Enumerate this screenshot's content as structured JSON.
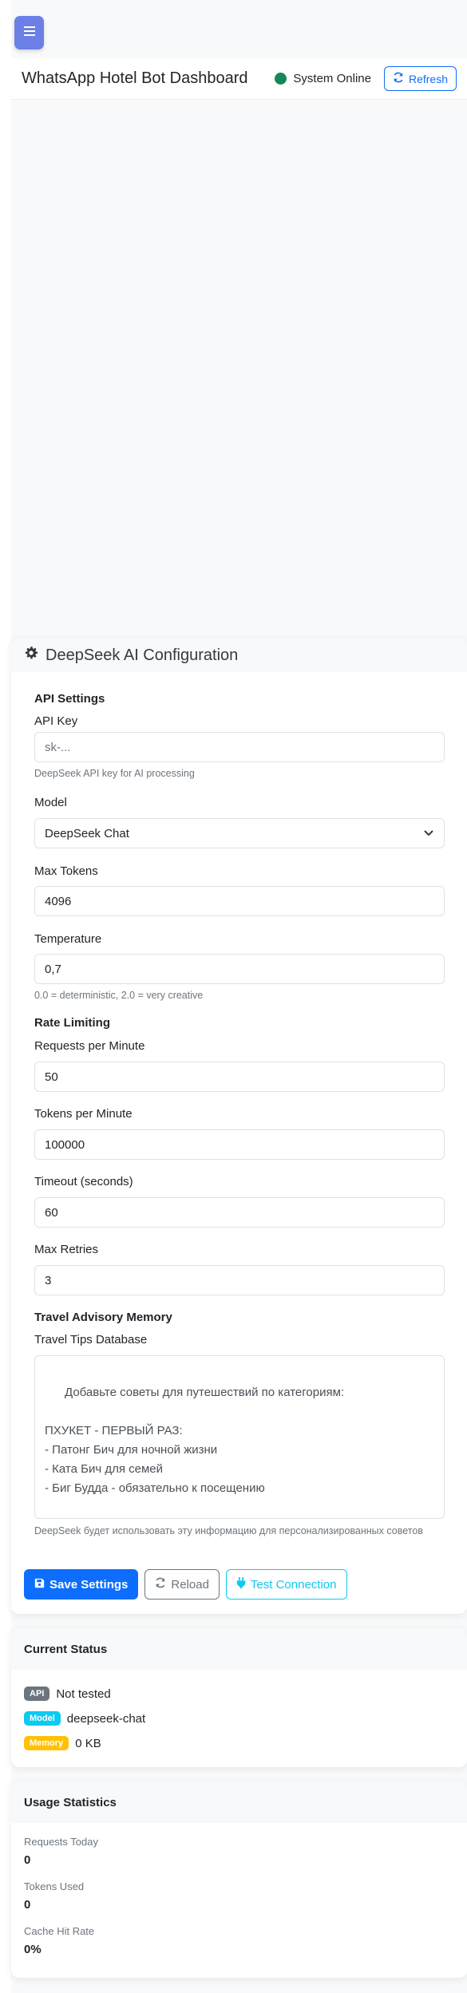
{
  "header": {
    "title": "WhatsApp Hotel Bot Dashboard",
    "status_text": "System Online",
    "refresh_label": "Refresh"
  },
  "config": {
    "title": "DeepSeek AI Configuration",
    "api_section": "API Settings",
    "api_key_label": "API Key",
    "api_key_placeholder": "sk-...",
    "api_key_help": "DeepSeek API key for AI processing",
    "model_label": "Model",
    "model_value": "DeepSeek Chat",
    "max_tokens_label": "Max Tokens",
    "max_tokens_value": "4096",
    "temperature_label": "Temperature",
    "temperature_value": "0,7",
    "temperature_help": "0.0 = deterministic, 2.0 = very creative",
    "rate_section": "Rate Limiting",
    "rpm_label": "Requests per Minute",
    "rpm_value": "50",
    "tpm_label": "Tokens per Minute",
    "tpm_value": "100000",
    "timeout_label": "Timeout (seconds)",
    "timeout_value": "60",
    "retries_label": "Max Retries",
    "retries_value": "3",
    "memory_section": "Travel Advisory Memory",
    "tips_label": "Travel Tips Database",
    "tips_value": "Добавьте советы для путешествий по категориям:\n\nПХУКЕТ - ПЕРВЫЙ РАЗ:\n- Патонг Бич для ночной жизни\n- Ката Бич для семей\n- Биг Будда - обязательно к посещению\n\nПХУКЕТ - С ДЕТЬМИ:",
    "tips_help": "DeepSeek будет использовать эту информацию для персонализированных советов",
    "save_label": "Save Settings",
    "reload_label": "Reload",
    "test_label": "Test Connection"
  },
  "current_status": {
    "title": "Current Status",
    "api_badge": "API",
    "api_value": "Not tested",
    "model_badge": "Model",
    "model_value": "deepseek-chat",
    "memory_badge": "Memory",
    "memory_value": "0 KB"
  },
  "usage": {
    "title": "Usage Statistics",
    "requests_label": "Requests Today",
    "requests_value": "0",
    "tokens_label": "Tokens Used",
    "tokens_value": "0",
    "cache_label": "Cache Hit Rate",
    "cache_value": "0%"
  },
  "colors": {
    "primary": "#0d6efd",
    "online": "#198754",
    "menu_button": "#6c7fe6",
    "info": "#0dcaf0",
    "warning": "#ffc107"
  }
}
